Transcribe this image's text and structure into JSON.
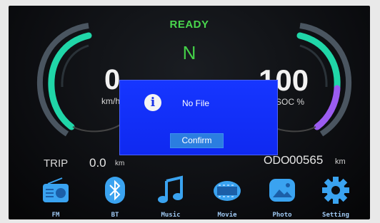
{
  "status": {
    "ready": "READY",
    "gear": "N"
  },
  "speed": {
    "value": "0",
    "unit": "km/h"
  },
  "battery": {
    "value": "100",
    "unit": "SOC %"
  },
  "trip": {
    "label": "TRIP",
    "value": "0.0",
    "unit": "km"
  },
  "odo": {
    "label": "ODO",
    "value": "00565",
    "unit": "km"
  },
  "dialog": {
    "message": "No File",
    "confirm_label": "Confirm"
  },
  "apps": [
    {
      "label": "FM",
      "icon": "radio-icon"
    },
    {
      "label": "BT",
      "icon": "bluetooth-icon"
    },
    {
      "label": "Music",
      "icon": "music-note-icon"
    },
    {
      "label": "Movie",
      "icon": "film-icon"
    },
    {
      "label": "Photo",
      "icon": "photo-icon"
    },
    {
      "label": "Setting",
      "icon": "gear-icon"
    }
  ],
  "colors": {
    "ready": "#49d64d",
    "dialog_bg": "#1636ff",
    "confirm_bg": "#2b7ee0",
    "app_icon": "#3aa3f0"
  }
}
